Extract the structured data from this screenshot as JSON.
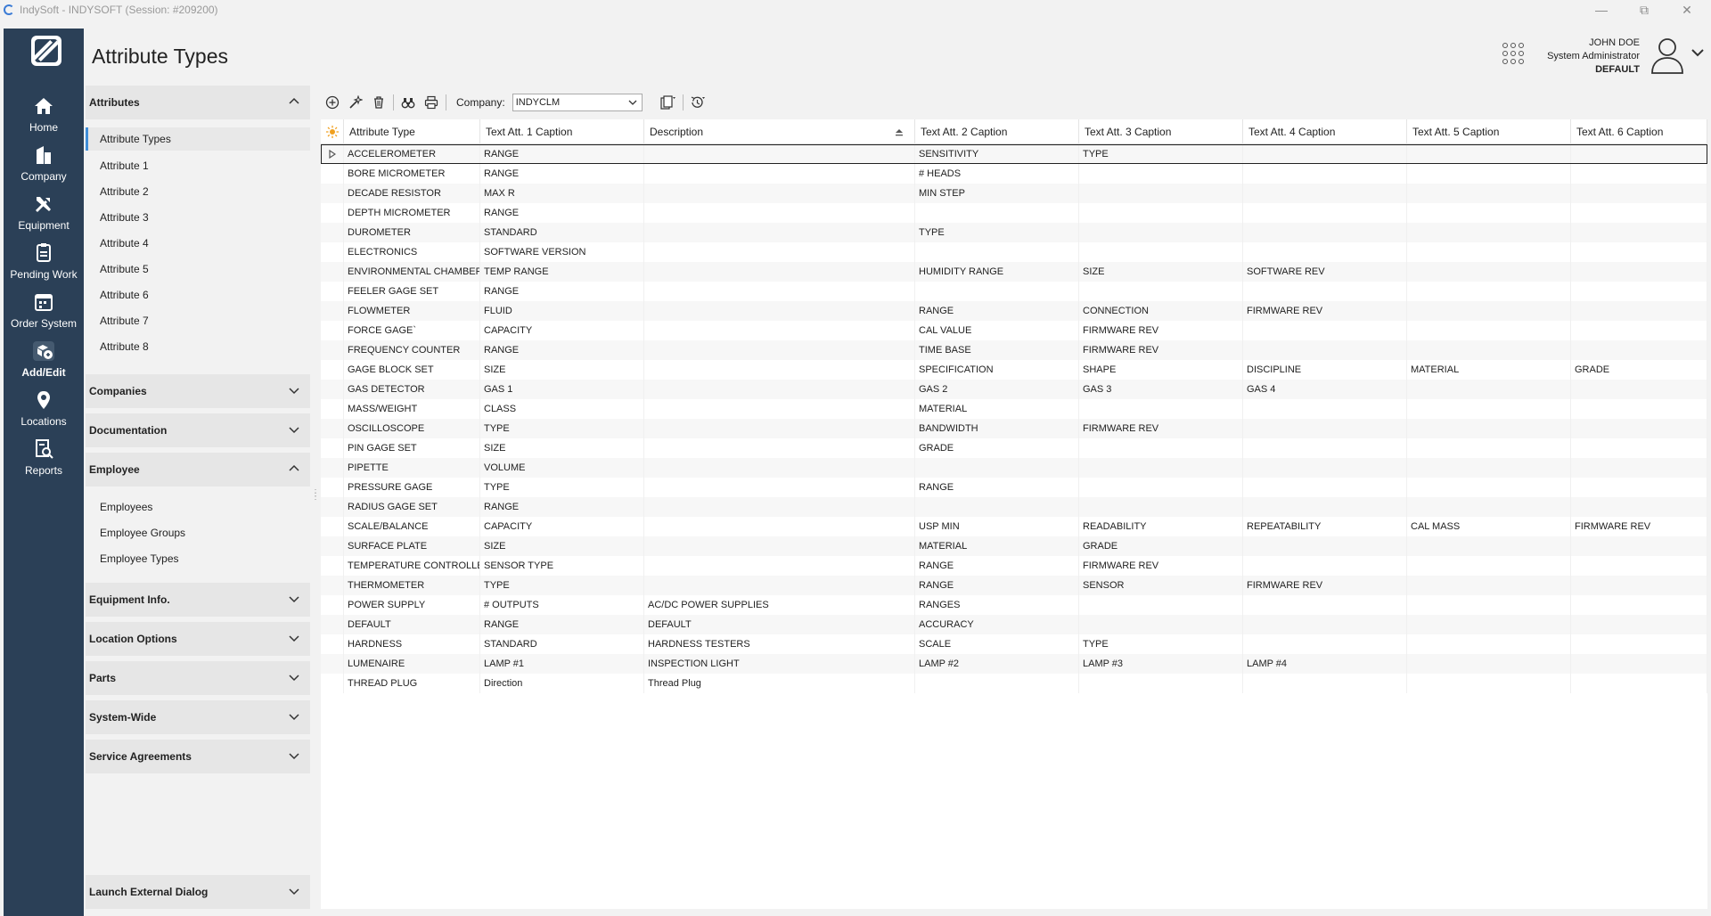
{
  "window": {
    "title": "IndySoft - INDYSOFT (Session: #209200)",
    "minimize_icon": "minimize-icon",
    "restore_icon": "restore-icon",
    "close_icon": "close-icon"
  },
  "nav": {
    "items": [
      {
        "label": "Home",
        "icon": "home-icon"
      },
      {
        "label": "Company",
        "icon": "company-icon"
      },
      {
        "label": "Equipment",
        "icon": "tools-icon"
      },
      {
        "label": "Pending Work",
        "icon": "pending-work-icon"
      },
      {
        "label": "Order System",
        "icon": "calendar-icon"
      },
      {
        "label": "Add/Edit",
        "icon": "add-edit-icon"
      },
      {
        "label": "Locations",
        "icon": "location-pin-icon"
      },
      {
        "label": "Reports",
        "icon": "reports-icon"
      }
    ],
    "active": "Add/Edit"
  },
  "page": {
    "title": "Attribute Types"
  },
  "user": {
    "name": "JOHN DOE",
    "role": "System Administrator",
    "profile": "DEFAULT"
  },
  "sidepanel": {
    "groups": [
      {
        "label": "Attributes",
        "expanded": true,
        "items": [
          "Attribute Types",
          "Attribute 1",
          "Attribute 2",
          "Attribute 3",
          "Attribute 4",
          "Attribute 5",
          "Attribute 6",
          "Attribute 7",
          "Attribute 8"
        ]
      },
      {
        "label": "Companies",
        "expanded": false
      },
      {
        "label": "Documentation",
        "expanded": false
      },
      {
        "label": "Employee",
        "expanded": true,
        "items": [
          "Employees",
          "Employee Groups",
          "Employee Types"
        ]
      },
      {
        "label": "Equipment Info.",
        "expanded": false
      },
      {
        "label": "Location Options",
        "expanded": false
      },
      {
        "label": "Parts",
        "expanded": false
      },
      {
        "label": "System-Wide",
        "expanded": false
      },
      {
        "label": "Service Agreements",
        "expanded": false
      },
      {
        "label": "Launch External Dialog",
        "expanded": false
      }
    ],
    "active_item": "Attribute Types"
  },
  "toolbar": {
    "company_label": "Company:",
    "company_value": "INDYCLM",
    "buttons": [
      "add-icon",
      "edit-wand-icon",
      "delete-icon",
      "find-binoculars-icon",
      "print-icon",
      "copy-icon",
      "history-icon"
    ]
  },
  "grid": {
    "columns": [
      "Attribute Type",
      "Text Att. 1 Caption",
      "Description",
      "Text Att. 2 Caption",
      "Text Att. 3 Caption",
      "Text Att. 4 Caption",
      "Text Att. 5 Caption",
      "Text Att. 6 Caption"
    ],
    "rows": [
      [
        "ACCELEROMETER",
        "RANGE",
        "",
        "SENSITIVITY",
        "TYPE",
        "",
        "",
        ""
      ],
      [
        "BORE MICROMETER",
        "RANGE",
        "",
        "# HEADS",
        "",
        "",
        "",
        ""
      ],
      [
        "DECADE RESISTOR",
        "MAX R",
        "",
        "MIN STEP",
        "",
        "",
        "",
        ""
      ],
      [
        "DEPTH MICROMETER",
        "RANGE",
        "",
        "",
        "",
        "",
        "",
        ""
      ],
      [
        "DUROMETER",
        "STANDARD",
        "",
        "TYPE",
        "",
        "",
        "",
        ""
      ],
      [
        "ELECTRONICS",
        "SOFTWARE VERSION",
        "",
        "",
        "",
        "",
        "",
        ""
      ],
      [
        "ENVIRONMENTAL CHAMBER",
        "TEMP RANGE",
        "",
        "HUMIDITY RANGE",
        "SIZE",
        "SOFTWARE REV",
        "",
        ""
      ],
      [
        "FEELER GAGE SET",
        "RANGE",
        "",
        "",
        "",
        "",
        "",
        ""
      ],
      [
        "FLOWMETER",
        "FLUID",
        "",
        "RANGE",
        "CONNECTION",
        "FIRMWARE REV",
        "",
        ""
      ],
      [
        "FORCE GAGE`",
        "CAPACITY",
        "",
        "CAL VALUE",
        "FIRMWARE REV",
        "",
        "",
        ""
      ],
      [
        "FREQUENCY COUNTER",
        "RANGE",
        "",
        "TIME BASE",
        "FIRMWARE REV",
        "",
        "",
        ""
      ],
      [
        "GAGE BLOCK SET",
        "SIZE",
        "",
        "SPECIFICATION",
        "SHAPE",
        "DISCIPLINE",
        "MATERIAL",
        "GRADE"
      ],
      [
        "GAS DETECTOR",
        "GAS 1",
        "",
        "GAS 2",
        "GAS 3",
        "GAS 4",
        "",
        ""
      ],
      [
        "MASS/WEIGHT",
        "CLASS",
        "",
        "MATERIAL",
        "",
        "",
        "",
        ""
      ],
      [
        "OSCILLOSCOPE",
        "TYPE",
        "",
        "BANDWIDTH",
        "FIRMWARE REV",
        "",
        "",
        ""
      ],
      [
        "PIN GAGE SET",
        "SIZE",
        "",
        "GRADE",
        "",
        "",
        "",
        ""
      ],
      [
        "PIPETTE",
        "VOLUME",
        "",
        "",
        "",
        "",
        "",
        ""
      ],
      [
        "PRESSURE GAGE",
        "TYPE",
        "",
        "RANGE",
        "",
        "",
        "",
        ""
      ],
      [
        "RADIUS GAGE SET",
        "RANGE",
        "",
        "",
        "",
        "",
        "",
        ""
      ],
      [
        "SCALE/BALANCE",
        "CAPACITY",
        "",
        "USP MIN",
        "READABILITY",
        "REPEATABILITY",
        "CAL MASS",
        "FIRMWARE REV"
      ],
      [
        "SURFACE PLATE",
        "SIZE",
        "",
        "MATERIAL",
        "GRADE",
        "",
        "",
        ""
      ],
      [
        "TEMPERATURE CONTROLLER",
        "SENSOR TYPE",
        "",
        "RANGE",
        "FIRMWARE REV",
        "",
        "",
        ""
      ],
      [
        "THERMOMETER",
        "TYPE",
        "",
        "RANGE",
        "SENSOR",
        "FIRMWARE REV",
        "",
        ""
      ],
      [
        "POWER SUPPLY",
        "# OUTPUTS",
        "AC/DC POWER SUPPLIES",
        "RANGES",
        "",
        "",
        "",
        ""
      ],
      [
        "DEFAULT",
        "RANGE",
        "DEFAULT",
        "ACCURACY",
        "",
        "",
        "",
        ""
      ],
      [
        "HARDNESS",
        "STANDARD",
        "HARDNESS TESTERS",
        "SCALE",
        "TYPE",
        "",
        "",
        ""
      ],
      [
        "LUMENAIRE",
        "LAMP #1",
        "INSPECTION LIGHT",
        "LAMP #2",
        "LAMP #3",
        "LAMP #4",
        "",
        ""
      ],
      [
        "THREAD PLUG",
        "Direction",
        "Thread Plug",
        "",
        "",
        "",
        "",
        ""
      ]
    ],
    "selected_row": 0
  },
  "colors": {
    "nav_bg": "#2b4057",
    "accent": "#3f8ed9",
    "filter_icon": "#f0a020"
  }
}
